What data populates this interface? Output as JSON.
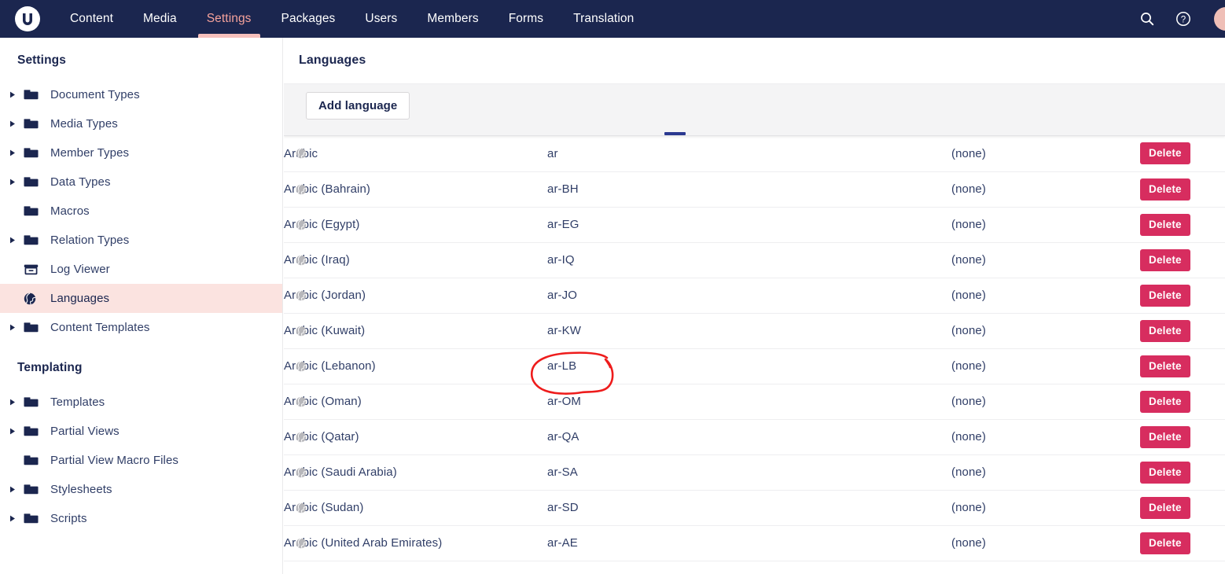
{
  "topnav": {
    "logo_icon": "umbraco-logo-icon",
    "items": [
      {
        "label": "Content",
        "active": false
      },
      {
        "label": "Media",
        "active": false
      },
      {
        "label": "Settings",
        "active": true
      },
      {
        "label": "Packages",
        "active": false
      },
      {
        "label": "Users",
        "active": false
      },
      {
        "label": "Members",
        "active": false
      },
      {
        "label": "Forms",
        "active": false
      },
      {
        "label": "Translation",
        "active": false
      }
    ],
    "search_icon": "search-icon",
    "help_icon": "help-icon",
    "avatar": "user-avatar",
    "background_color": "#1b264f",
    "active_color": "#f5a29b",
    "active_underline_color": "#f6c0bc"
  },
  "sidebar": {
    "tree_header": "Settings",
    "items": [
      {
        "label": "Document Types",
        "icon": "folder-icon",
        "caret": true,
        "selected": false
      },
      {
        "label": "Media Types",
        "icon": "folder-icon",
        "caret": true,
        "selected": false
      },
      {
        "label": "Member Types",
        "icon": "folder-icon",
        "caret": true,
        "selected": false
      },
      {
        "label": "Data Types",
        "icon": "folder-icon",
        "caret": true,
        "selected": false
      },
      {
        "label": "Macros",
        "icon": "folder-icon",
        "caret": false,
        "selected": false
      },
      {
        "label": "Relation Types",
        "icon": "folder-icon",
        "caret": true,
        "selected": false
      },
      {
        "label": "Log Viewer",
        "icon": "archive-icon",
        "caret": false,
        "selected": false
      },
      {
        "label": "Languages",
        "icon": "globe-icon",
        "caret": false,
        "selected": true
      },
      {
        "label": "Content Templates",
        "icon": "folder-icon",
        "caret": true,
        "selected": false
      }
    ],
    "section_title": "Templating",
    "templating_items": [
      {
        "label": "Templates",
        "icon": "folder-icon",
        "caret": true,
        "selected": false
      },
      {
        "label": "Partial Views",
        "icon": "folder-icon",
        "caret": true,
        "selected": false
      },
      {
        "label": "Partial View Macro Files",
        "icon": "folder-icon",
        "caret": false,
        "selected": false
      },
      {
        "label": "Stylesheets",
        "icon": "folder-icon",
        "caret": true,
        "selected": false
      },
      {
        "label": "Scripts",
        "icon": "folder-icon",
        "caret": true,
        "selected": false
      }
    ],
    "selected_background": "#fbe3e0"
  },
  "main": {
    "page_title": "Languages",
    "add_language_label": "Add language",
    "table": {
      "sorted_column_indicator_color": "#2b3990",
      "delete_label": "Delete",
      "row_icon": "globe-icon",
      "rows": [
        {
          "name": "Arabic",
          "iso": "ar",
          "fallback": "(none)"
        },
        {
          "name": "Arabic (Bahrain)",
          "iso": "ar-BH",
          "fallback": "(none)"
        },
        {
          "name": "Arabic (Egypt)",
          "iso": "ar-EG",
          "fallback": "(none)"
        },
        {
          "name": "Arabic (Iraq)",
          "iso": "ar-IQ",
          "fallback": "(none)"
        },
        {
          "name": "Arabic (Jordan)",
          "iso": "ar-JO",
          "fallback": "(none)"
        },
        {
          "name": "Arabic (Kuwait)",
          "iso": "ar-KW",
          "fallback": "(none)"
        },
        {
          "name": "Arabic (Lebanon)",
          "iso": "ar-LB",
          "fallback": "(none)"
        },
        {
          "name": "Arabic (Oman)",
          "iso": "ar-OM",
          "fallback": "(none)"
        },
        {
          "name": "Arabic (Qatar)",
          "iso": "ar-QA",
          "fallback": "(none)"
        },
        {
          "name": "Arabic (Saudi Arabia)",
          "iso": "ar-SA",
          "fallback": "(none)"
        },
        {
          "name": "Arabic (Sudan)",
          "iso": "ar-SD",
          "fallback": "(none)"
        },
        {
          "name": "Arabic (United Arab Emirates)",
          "iso": "ar-AE",
          "fallback": "(none)"
        }
      ]
    },
    "delete_button_color": "#d72d5f"
  },
  "annotation": {
    "shape": "hand-drawn-ellipse",
    "color": "#ee1c1c",
    "targets_text": "ar-LB"
  }
}
